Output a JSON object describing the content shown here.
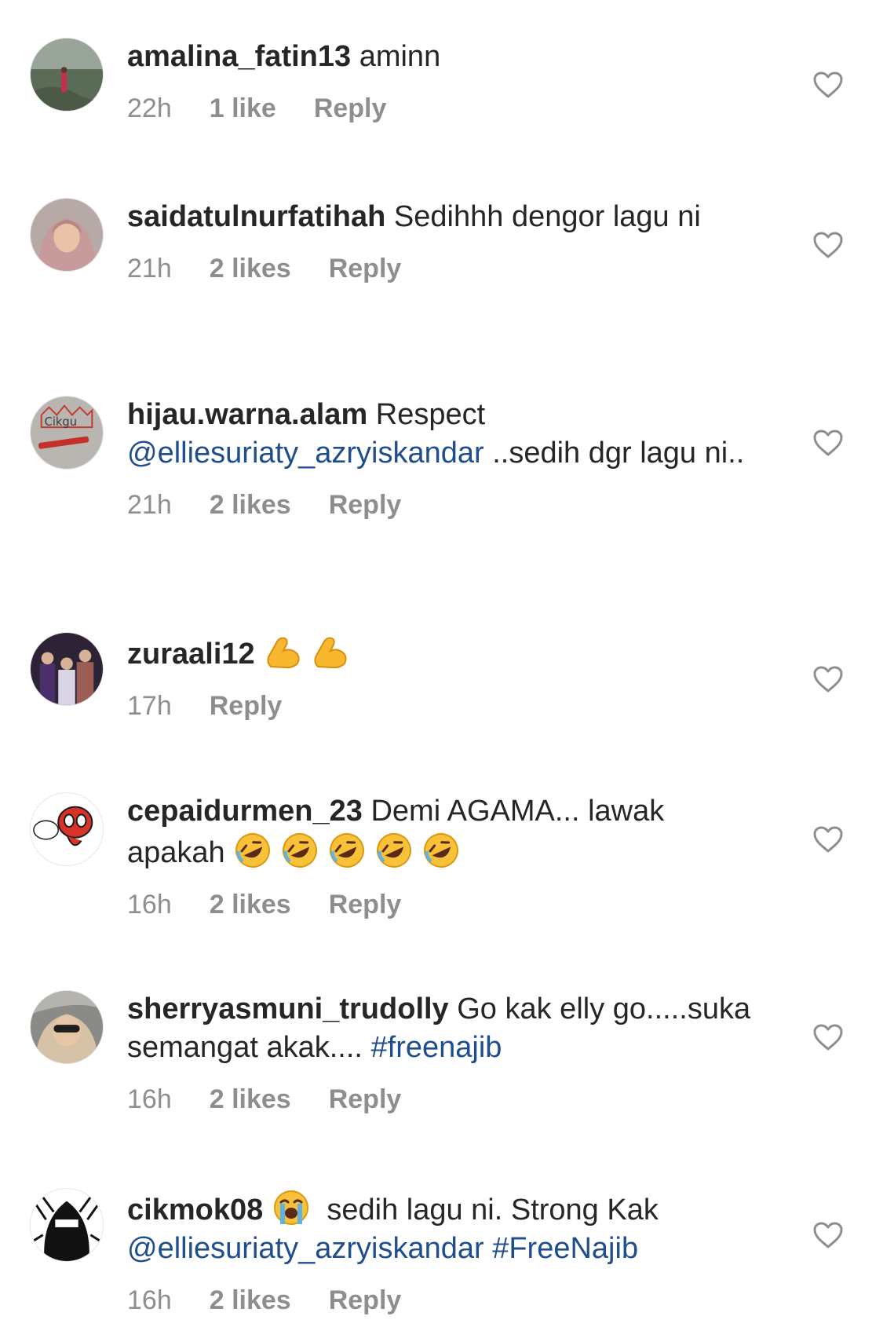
{
  "comments": [
    {
      "username": "amalina_fatin13",
      "text": " aminn",
      "time": "22h",
      "likes": "1 like",
      "reply": "Reply"
    },
    {
      "username": "saidatulnurfatihah",
      "text": " Sedihhh dengor lagu ni",
      "time": "21h",
      "likes": "2 likes",
      "reply": "Reply"
    },
    {
      "username": "hijau.warna.alam",
      "text_before": " Respect ",
      "mention": "@elliesuriaty_azryiskandar",
      "text_after": " ..sedih dgr lagu ni..",
      "time": "21h",
      "likes": "2 likes",
      "reply": "Reply"
    },
    {
      "username": "zuraali12",
      "emoji": "flexed-biceps-emoji",
      "emoji_count": 2,
      "time": "17h",
      "reply": "Reply"
    },
    {
      "username": "cepaidurmen_23",
      "text": " Demi AGAMA... lawak apakah ",
      "emoji": "rolling-on-floor-laughing-emoji",
      "emoji_count": 5,
      "time": "16h",
      "likes": "2 likes",
      "reply": "Reply"
    },
    {
      "username": "sherryasmuni_trudolly",
      "text": " Go kak elly go.....suka semangat akak.... ",
      "hashtag": "#freenajib",
      "time": "16h",
      "likes": "2 likes",
      "reply": "Reply"
    },
    {
      "username": "cikmok08",
      "emoji": "loudly-crying-face-emoji",
      "text_after_emoji": " sedih lagu ni. Strong Kak ",
      "mention": "@elliesuriaty_azryiskandar",
      "hashtag": " #FreeNajib",
      "time": "16h",
      "likes": "2 likes",
      "reply": "Reply"
    }
  ],
  "icons": {
    "like": "heart-outline-icon"
  },
  "colors": {
    "text": "#262626",
    "meta": "#8e8e8e",
    "link": "#1f4e8c",
    "background": "#ffffff"
  }
}
